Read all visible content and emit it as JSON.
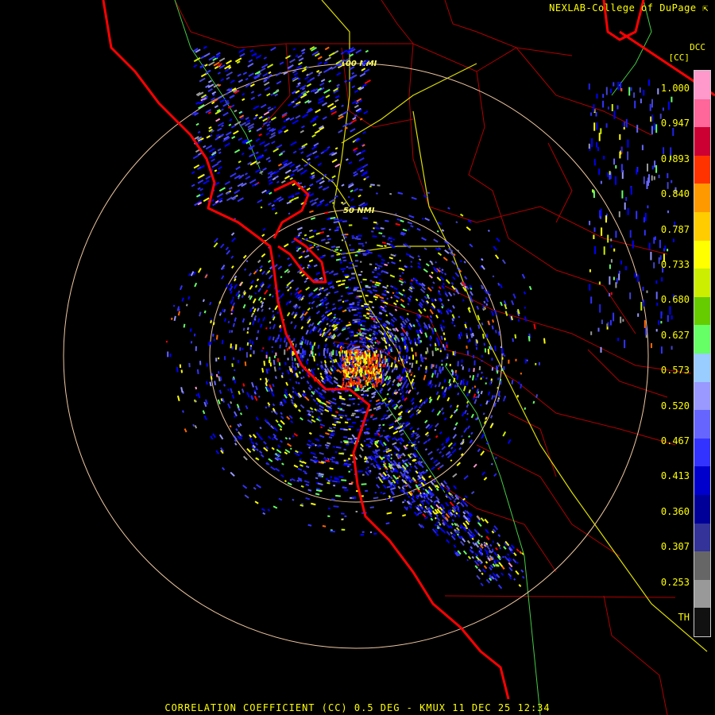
{
  "header": {
    "credit": "NEXLAB-College of DuPage",
    "credit_icon": "external-link-icon",
    "site_code": "DCC",
    "product_code": "[CC]"
  },
  "rings": [
    {
      "label": "100 NMI"
    },
    {
      "label": "50 NMI"
    }
  ],
  "legend": {
    "ticks": [
      "1.000",
      "0.947",
      "0.893",
      "0.840",
      "0.787",
      "0.733",
      "0.680",
      "0.627",
      "0.573",
      "0.520",
      "0.467",
      "0.413",
      "0.360",
      "0.307",
      "0.253",
      "TH"
    ],
    "colors": [
      "#ff99cc",
      "#ff6699",
      "#cc0033",
      "#ff3300",
      "#ff9900",
      "#ffcc00",
      "#ffff00",
      "#ccee00",
      "#66cc00",
      "#66ff66",
      "#99ccff",
      "#9999ff",
      "#6666ff",
      "#3333ff",
      "#0000cc",
      "#000099",
      "#333399",
      "#666666",
      "#999999",
      "#111111"
    ]
  },
  "footer": {
    "caption": "CORRELATION COEFFICIENT (CC) 0.5 DEG - KMUX 11 DEC 25 12:34"
  },
  "colors": {
    "coastline": "#ff0000",
    "county": "#cc0000",
    "highway": "#ffff00",
    "river": "#66ff66",
    "ring": "#ffccaa",
    "text": "#ffff00"
  }
}
